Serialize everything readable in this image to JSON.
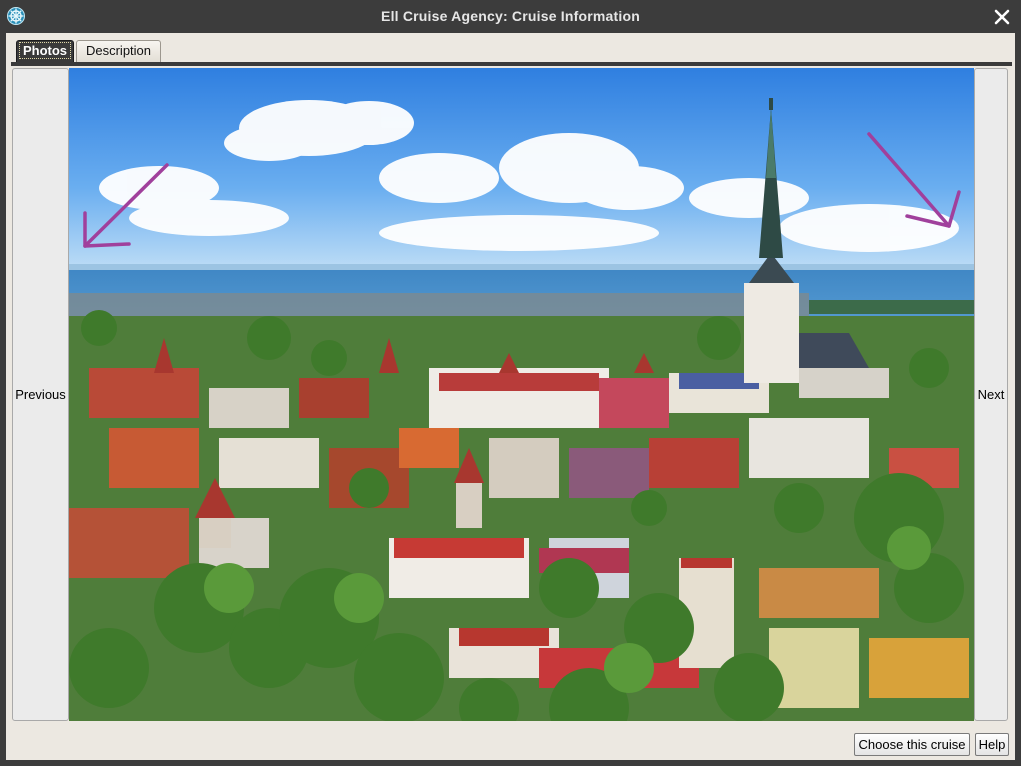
{
  "window": {
    "title": "Ell Cruise Agency: Cruise Information",
    "title_bar_color": "#3c3c3c",
    "icon": "ship-wheel-icon",
    "close_icon": "close-icon"
  },
  "tabs": [
    {
      "label": "Photos",
      "active": true
    },
    {
      "label": "Description",
      "active": false
    }
  ],
  "navigation": {
    "previous_label": "Previous",
    "next_label": "Next"
  },
  "photo": {
    "subject": "aerial-city-old-town-harbor-photo",
    "annotations": [
      "arrow-pointing-to-previous-icon",
      "arrow-pointing-to-next-icon"
    ],
    "arrow_color": "#a0409c"
  },
  "footer": {
    "choose_label": "Choose this cruise",
    "help_label": "Help"
  }
}
